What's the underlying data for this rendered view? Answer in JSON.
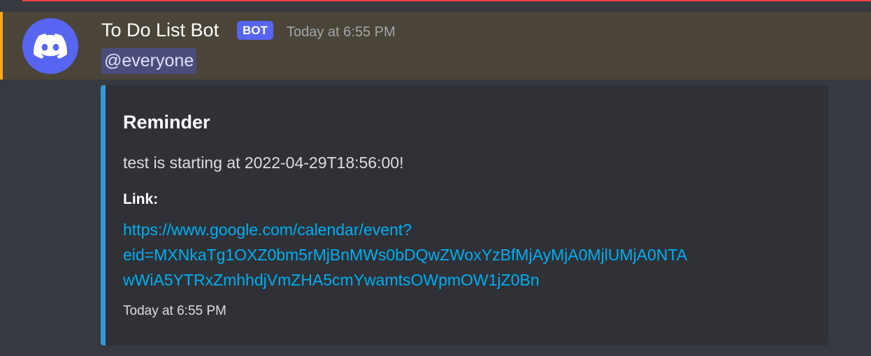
{
  "message": {
    "author": "To Do List Bot",
    "bot_tag": "BOT",
    "timestamp": "Today at 6:55 PM",
    "mention": "@everyone",
    "avatar_icon": "discord-logo-icon"
  },
  "embed": {
    "title": "Reminder",
    "description": "test is starting at 2022-04-29T18:56:00!",
    "field": {
      "name": "Link:",
      "link_lines": [
        "https://www.google.com/calendar/event?",
        "eid=MXNkaTg1OXZ0bm5rMjBnMWs0bDQwZWoxYzBfMjAyMjA0MjlUMjA0NTA",
        "wWiA5YTRxZmhhdjVmZHA5cmYwamtsOWpmOW1jZ0Bn"
      ]
    },
    "footer": "Today at 6:55 PM",
    "accent_color": "#3498db"
  },
  "colors": {
    "background": "#36393f",
    "mention_highlight": "#4a4538",
    "mention_bar": "#faa81a",
    "blurple": "#5865f2",
    "link": "#00aff4"
  }
}
